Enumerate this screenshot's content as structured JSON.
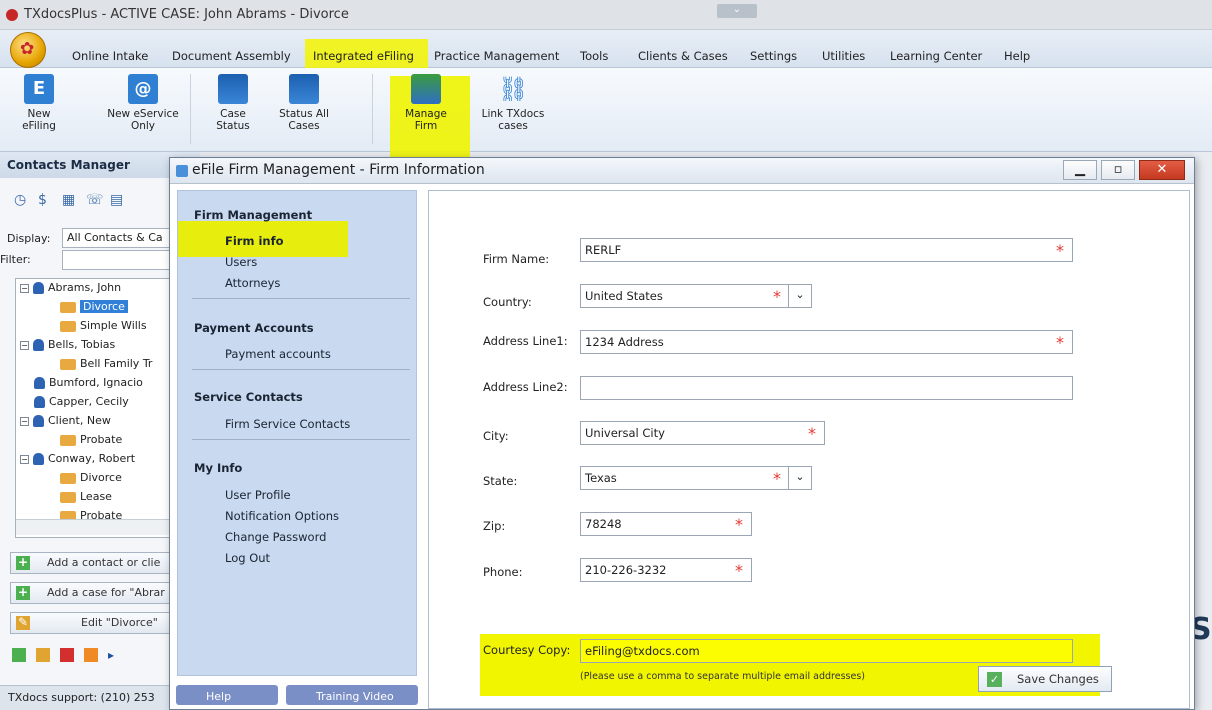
{
  "window": {
    "title": "TXdocsPlus - ACTIVE CASE: John Abrams - Divorce"
  },
  "menu": {
    "items": [
      "Online Intake",
      "Document Assembly",
      "Integrated eFiling",
      "Practice Management",
      "Tools",
      "Clients & Cases",
      "Settings",
      "Utilities",
      "Learning Center",
      "Help"
    ]
  },
  "ribbon": {
    "buttons": [
      {
        "l1": "New",
        "l2": "eFiling",
        "icon": "efiling-icon"
      },
      {
        "l1": "New eService",
        "l2": "Only",
        "icon": "eservice-icon"
      },
      {
        "l1": "Case",
        "l2": "Status",
        "icon": "case-status-icon"
      },
      {
        "l1": "Status All",
        "l2": "Cases",
        "icon": "status-all-icon"
      },
      {
        "l1": "Manage",
        "l2": "Firm",
        "icon": "manage-firm-icon"
      },
      {
        "l1": "Link TXdocs",
        "l2": "cases",
        "icon": "link-icon"
      }
    ]
  },
  "contacts": {
    "header": "Contacts Manager",
    "display_label": "Display:",
    "display_value": "All Contacts & Ca",
    "filter_label": "Filter:",
    "tree": [
      {
        "label": "Abrams, John",
        "type": "person"
      },
      {
        "label": "Divorce",
        "type": "case",
        "selected": true
      },
      {
        "label": "Simple Wills",
        "type": "case"
      },
      {
        "label": "Bells, Tobias",
        "type": "person"
      },
      {
        "label": "Bell Family Tr",
        "type": "case"
      },
      {
        "label": "Bumford, Ignacio",
        "type": "person"
      },
      {
        "label": "Capper, Cecily",
        "type": "person"
      },
      {
        "label": "Client, New",
        "type": "person"
      },
      {
        "label": "Probate",
        "type": "case"
      },
      {
        "label": "Conway, Robert",
        "type": "person"
      },
      {
        "label": "Divorce",
        "type": "case"
      },
      {
        "label": "Lease",
        "type": "case"
      },
      {
        "label": "Probate",
        "type": "case"
      }
    ],
    "add_contact": "Add a contact or clie",
    "add_case": "Add a case for \"Abrar",
    "edit_case": "Edit \"Divorce\"",
    "support": "TXdocs support: (210) 253"
  },
  "dialog": {
    "title": "eFile Firm Management - Firm Information",
    "nav": {
      "firm_management": "Firm Management",
      "firm_info": "Firm info",
      "users": "Users",
      "attorneys": "Attorneys",
      "payment_accounts_h": "Payment Accounts",
      "payment_accounts": "Payment accounts",
      "service_contacts_h": "Service Contacts",
      "firm_service_contacts": "Firm Service Contacts",
      "my_info": "My Info",
      "user_profile": "User Profile",
      "notification_options": "Notification Options",
      "change_password": "Change Password",
      "log_out": "Log Out"
    },
    "help": "Help",
    "training_video": "Training Video",
    "form": {
      "firm_name_label": "Firm Name:",
      "firm_name": "RERLF",
      "country_label": "Country:",
      "country": "United States",
      "address1_label": "Address Line1:",
      "address1": "1234 Address",
      "address2_label": "Address Line2:",
      "address2": "",
      "city_label": "City:",
      "city": "Universal City",
      "state_label": "State:",
      "state": "Texas",
      "zip_label": "Zip:",
      "zip": "78248",
      "phone_label": "Phone:",
      "phone": "210-226-3232",
      "courtesy_label": "Courtesy Copy:",
      "courtesy": "eFiling@txdocs.com",
      "courtesy_hint": "(Please use a comma to separate multiple email addresses)",
      "save": "Save Changes",
      "required_mark": "*"
    }
  },
  "colors": {
    "highlight": "#f1f500",
    "accent": "#2f80d6",
    "required": "#e53935"
  }
}
